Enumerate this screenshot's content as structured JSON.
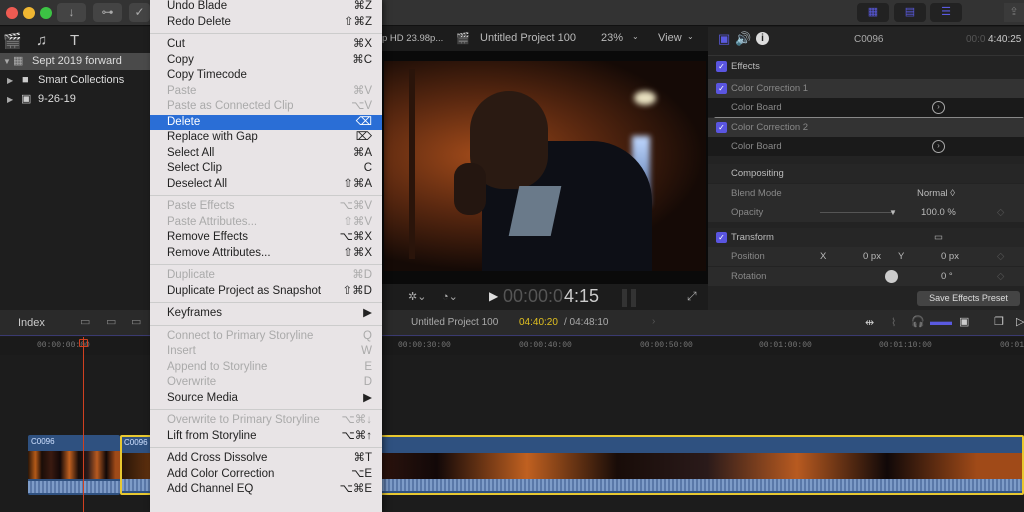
{
  "toolbar": {
    "buttons": [
      "import-icon",
      "keyword-icon",
      "check-icon"
    ],
    "right_buttons": [
      "browser-layout-icon",
      "timeline-layout-icon",
      "inspector-layout-icon"
    ]
  },
  "library": {
    "items": [
      {
        "label": "Sept 2019 forward",
        "selected": true
      },
      {
        "label": "Smart Collections",
        "selected": false
      },
      {
        "label": "9-26-19",
        "selected": false
      }
    ]
  },
  "menu": {
    "items": [
      {
        "label": "Undo Blade",
        "shortcut": "⌘Z",
        "disabled": false
      },
      {
        "label": "Redo Delete",
        "shortcut": "⇧⌘Z",
        "disabled": false
      },
      {
        "sep": true
      },
      {
        "label": "Cut",
        "shortcut": "⌘X",
        "disabled": false
      },
      {
        "label": "Copy",
        "shortcut": "⌘C",
        "disabled": false
      },
      {
        "label": "Copy Timecode",
        "shortcut": "",
        "disabled": false
      },
      {
        "label": "Paste",
        "shortcut": "⌘V",
        "disabled": true
      },
      {
        "label": "Paste as Connected Clip",
        "shortcut": "⌥V",
        "disabled": true
      },
      {
        "label": "Delete",
        "shortcut": "⌫",
        "disabled": false,
        "highlighted": true
      },
      {
        "label": "Replace with Gap",
        "shortcut": "⌦",
        "disabled": false
      },
      {
        "label": "Select All",
        "shortcut": "⌘A",
        "disabled": false
      },
      {
        "label": "Select Clip",
        "shortcut": "C",
        "disabled": false
      },
      {
        "label": "Deselect All",
        "shortcut": "⇧⌘A",
        "disabled": false
      },
      {
        "sep": true
      },
      {
        "label": "Paste Effects",
        "shortcut": "⌥⌘V",
        "disabled": true
      },
      {
        "label": "Paste Attributes...",
        "shortcut": "⇧⌘V",
        "disabled": true
      },
      {
        "label": "Remove Effects",
        "shortcut": "⌥⌘X",
        "disabled": false
      },
      {
        "label": "Remove Attributes...",
        "shortcut": "⇧⌘X",
        "disabled": false
      },
      {
        "sep": true
      },
      {
        "label": "Duplicate",
        "shortcut": "⌘D",
        "disabled": true
      },
      {
        "label": "Duplicate Project as Snapshot",
        "shortcut": "⇧⌘D",
        "disabled": false
      },
      {
        "sep": true
      },
      {
        "label": "Keyframes",
        "shortcut": "▶",
        "disabled": false
      },
      {
        "sep": true
      },
      {
        "label": "Connect to Primary Storyline",
        "shortcut": "Q",
        "disabled": true
      },
      {
        "label": "Insert",
        "shortcut": "W",
        "disabled": true
      },
      {
        "label": "Append to Storyline",
        "shortcut": "E",
        "disabled": true
      },
      {
        "label": "Overwrite",
        "shortcut": "D",
        "disabled": true
      },
      {
        "label": "Source Media",
        "shortcut": "▶",
        "disabled": false
      },
      {
        "sep": true
      },
      {
        "label": "Overwrite to Primary Storyline",
        "shortcut": "⌥⌘↓",
        "disabled": true
      },
      {
        "label": "Lift from Storyline",
        "shortcut": "⌥⌘↑",
        "disabled": false
      },
      {
        "sep": true
      },
      {
        "label": "Add Cross Dissolve",
        "shortcut": "⌘T",
        "disabled": false
      },
      {
        "label": "Add Color Correction",
        "shortcut": "⌥E",
        "disabled": false
      },
      {
        "label": "Add Channel EQ",
        "shortcut": "⌥⌘E",
        "disabled": false
      }
    ]
  },
  "viewer": {
    "format": "p HD 23.98p...",
    "project": "Untitled Project 100",
    "zoom": "23%",
    "view": "View",
    "timecode_dim": "00:00:0",
    "timecode": "4:15"
  },
  "inspector": {
    "clip_name": "C0096",
    "timecode_dim": "00:0",
    "timecode": "4:40:25",
    "effects_label": "Effects",
    "cc1": "Color Correction 1",
    "cc2": "Color Correction 2",
    "color_board": "Color Board",
    "compositing": "Compositing",
    "blend_mode_label": "Blend Mode",
    "blend_mode_value": "Normal ◊",
    "opacity_label": "Opacity",
    "opacity_value": "100.0  %",
    "transform": "Transform",
    "position_label": "Position",
    "x_label": "X",
    "x_value": "0  px",
    "y_label": "Y",
    "y_value": "0  px",
    "rotation_label": "Rotation",
    "rotation_value": "0  °",
    "save_preset": "Save Effects Preset"
  },
  "timeline": {
    "index_label": "Index",
    "project": "Untitled Project 100",
    "current_tc": "04:40:20",
    "total_tc": "/ 04:48:10",
    "ruler": [
      "00:00:00:00",
      "00:00:30:00",
      "00:00:40:00",
      "00:00:50:00",
      "00:01:00:00",
      "00:01:10:00",
      "00:01"
    ],
    "clips": [
      "C0096",
      "C0096"
    ]
  }
}
